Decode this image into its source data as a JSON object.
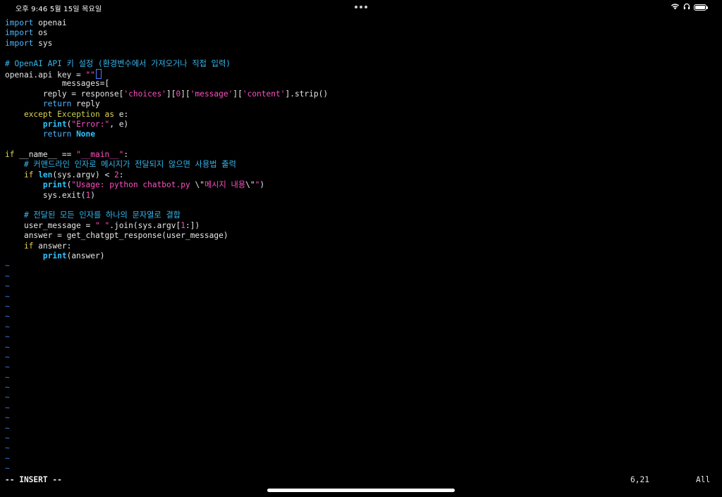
{
  "status_bar": {
    "time": "오후 9:46",
    "date": "5월 15일 목요일",
    "wifi_icon": "wifi-icon",
    "headphones_icon": "headphones-icon",
    "battery_icon": "battery-icon"
  },
  "code": {
    "l1_kw": "import",
    "l1_rest": " openai",
    "l2_kw": "import",
    "l2_rest": " os",
    "l3_kw": "import",
    "l3_rest": " sys",
    "l5": "# OpenAI API 키 설정 (환경변수에서 가져오거나 직접 입력)",
    "l6_a": "openai.api_key = ",
    "l6_str": "\"\"",
    "l7": "            messages=[",
    "l8_a": "        reply = response[",
    "l8_s1": "'choices'",
    "l8_b": "][",
    "l8_n": "0",
    "l8_c": "][",
    "l8_s2": "'message'",
    "l8_d": "][",
    "l8_s3": "'content'",
    "l8_e": "].strip()",
    "l9_kw": "return",
    "l9_rest": " reply",
    "l10_kw": "except",
    "l10_exc": "Exception",
    "l10_as": "as",
    "l10_rest": " e:",
    "l11_kw": "print",
    "l11_a": "(",
    "l11_str": "\"Error:\"",
    "l11_b": ", e)",
    "l12_kw": "return",
    "l12_none": "None",
    "l14_if": "if",
    "l14_a": " __name__ == ",
    "l14_str": "\"__main__\"",
    "l14_b": ":",
    "l15": "# 커맨드라인 인자로 메시지가 전달되지 않으면 사용법 출력",
    "l16_if": "if",
    "l16_len": "len",
    "l16_a": "(sys.argv) < ",
    "l16_n": "2",
    "l16_b": ":",
    "l17_kw": "print",
    "l17_a": "(",
    "l17_s1": "\"Usage: python chatbot.py ",
    "l17_esc1": "\\\"",
    "l17_s2": "메시지 내용",
    "l17_esc2": "\\\"",
    "l17_s3": "\"",
    "l17_b": ")",
    "l18_a": "sys.exit(",
    "l18_n": "1",
    "l18_b": ")",
    "l20": "# 전달된 모든 인자를 하나의 문자열로 결합",
    "l21_a": "user_message = ",
    "l21_str": "\" \"",
    "l21_b": ".join(sys.argv[",
    "l21_n": "1",
    "l21_c": ":])",
    "l22": "answer = get_chatgpt_response(user_message)",
    "l23_if": "if",
    "l23_rest": " answer:",
    "l24_kw": "print",
    "l24_rest": "(answer)",
    "tilde": "~"
  },
  "modeline": {
    "mode": "-- INSERT --",
    "position": "6,21",
    "scroll": "All"
  },
  "colors": {
    "background": "#000000",
    "keyword": "#4fb6ff",
    "string": "#ff4fc4",
    "comment": "#35b7ee",
    "tilde": "#3f78d6"
  }
}
